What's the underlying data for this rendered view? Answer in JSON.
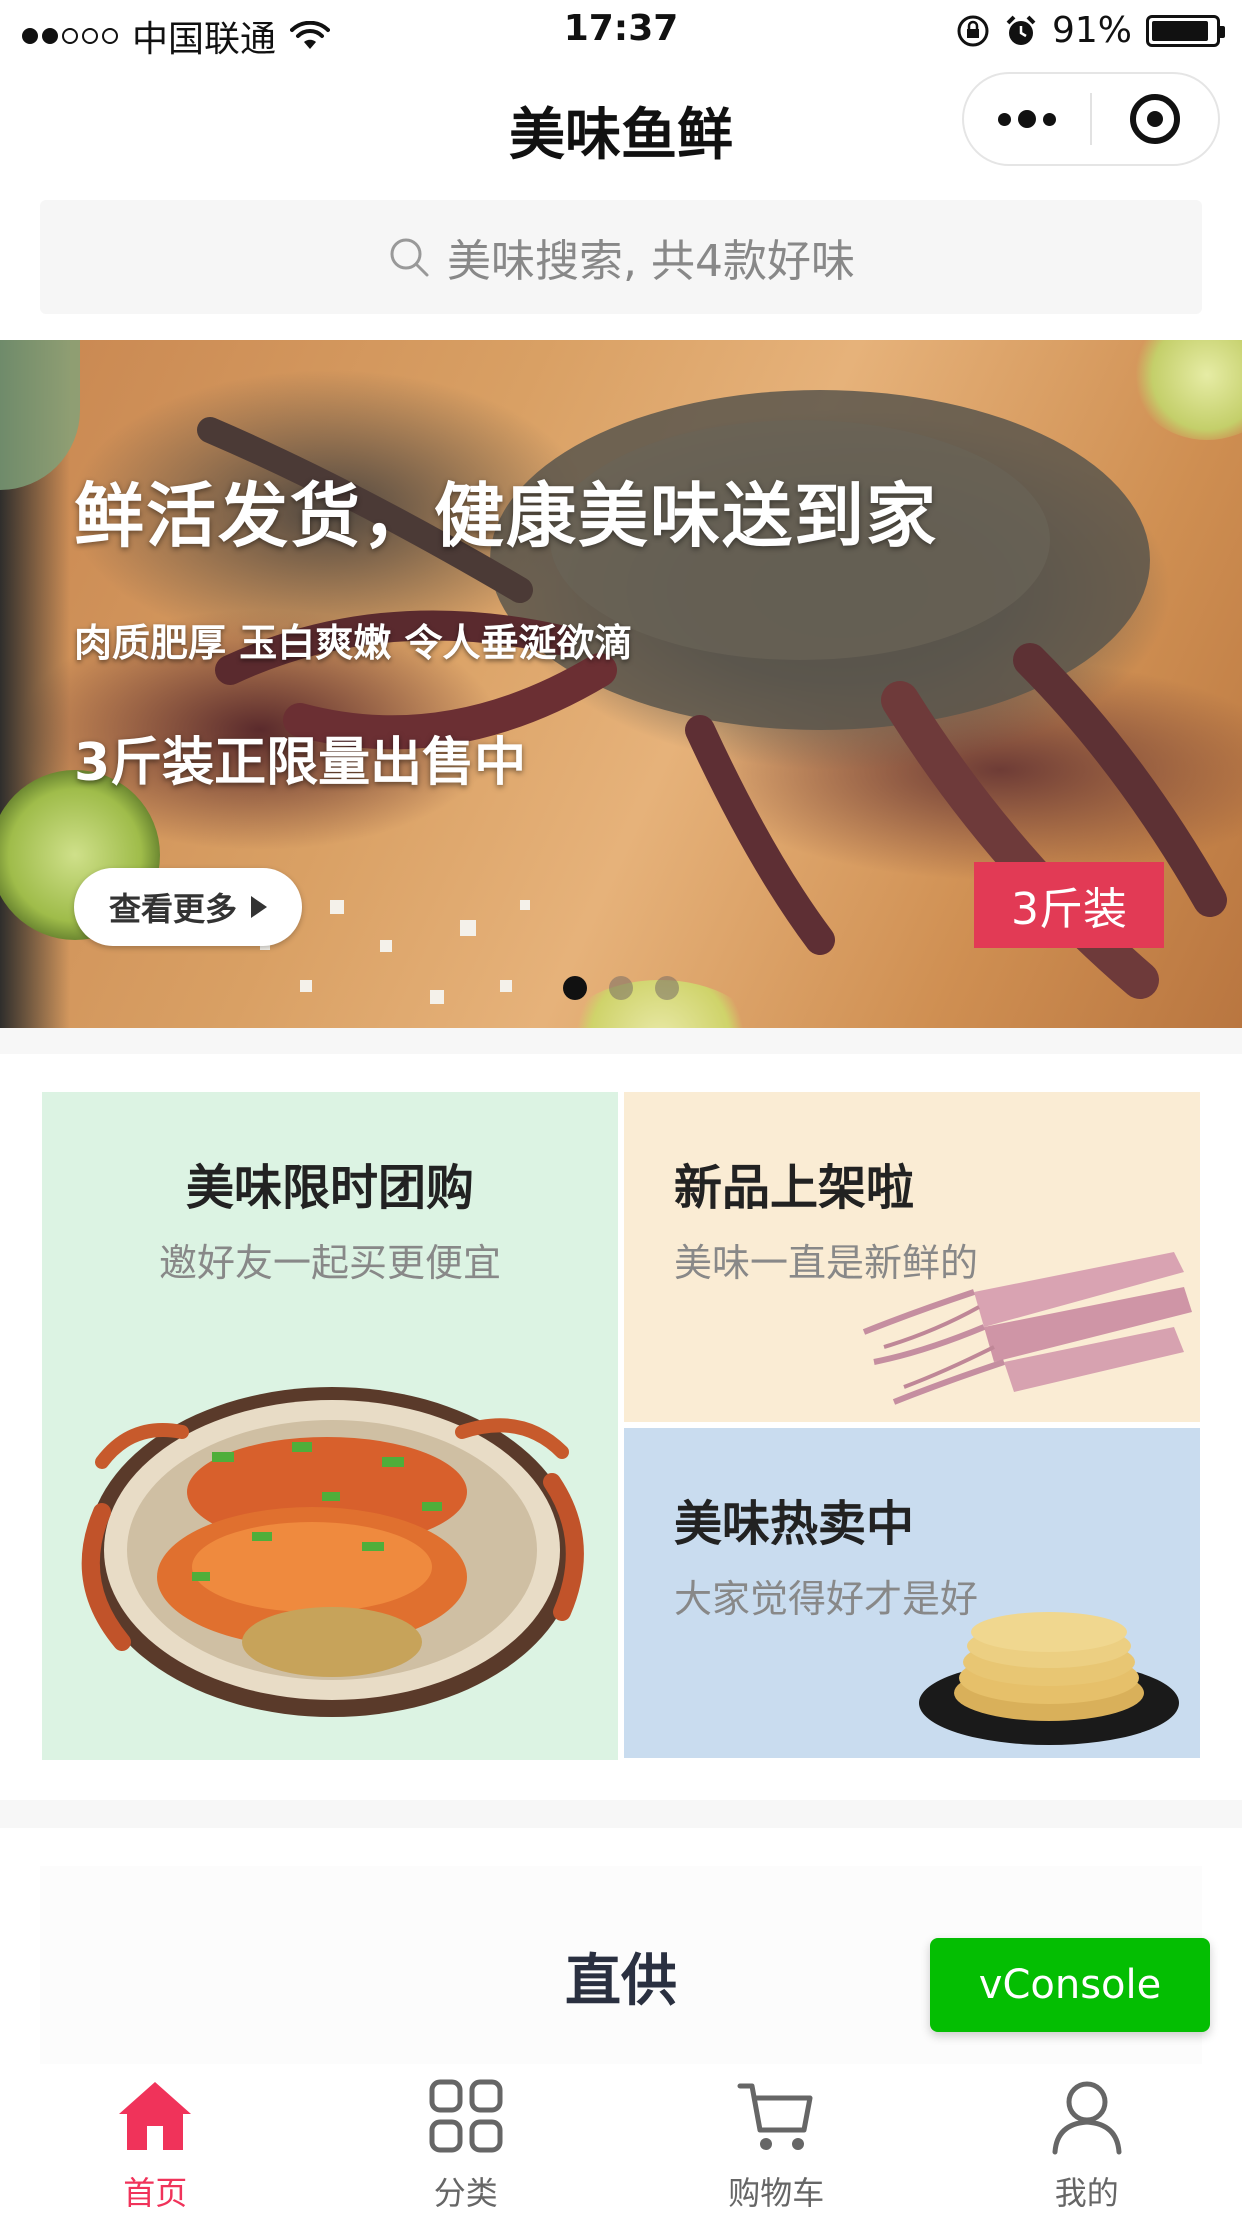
{
  "status_bar": {
    "carrier": "中国联通",
    "time": "17:37",
    "battery": "91%",
    "battery_level": 0.91,
    "signal_bars_filled": 2,
    "signal_bars_total": 5
  },
  "nav": {
    "title": "美味鱼鲜"
  },
  "search": {
    "placeholder": "美味搜索, 共4款好味"
  },
  "banner": {
    "headline": "鲜活发货，健康美味送到家",
    "subline": "肉质肥厚 玉白爽嫩 令人垂涎欲滴",
    "promo": "3斤装正限量出售中",
    "button_label": "查看更多",
    "tag": "3斤装",
    "slide_count": 3,
    "active_slide": 1
  },
  "promos": {
    "group_buy": {
      "title": "美味限时团购",
      "subtitle": "邀好友一起买更便宜"
    },
    "new_arrivals": {
      "title": "新品上架啦",
      "subtitle": "美味一直是新鲜的"
    },
    "hot_sale": {
      "title": "美味热卖中",
      "subtitle": "大家觉得好才是好"
    }
  },
  "section": {
    "title": "直供"
  },
  "vconsole": {
    "label": "vConsole"
  },
  "tabbar": {
    "items": [
      {
        "label": "首页",
        "icon": "home-icon",
        "active": true
      },
      {
        "label": "分类",
        "icon": "grid-icon",
        "active": false
      },
      {
        "label": "购物车",
        "icon": "cart-icon",
        "active": false
      },
      {
        "label": "我的",
        "icon": "user-icon",
        "active": false
      }
    ]
  },
  "colors": {
    "accent": "#f0335a",
    "tag_red": "#e23a55",
    "vconsole_green": "#04be02",
    "promo_green": "#dcf3e3",
    "promo_beige": "#faecd4",
    "promo_blue": "#c9dcef"
  }
}
